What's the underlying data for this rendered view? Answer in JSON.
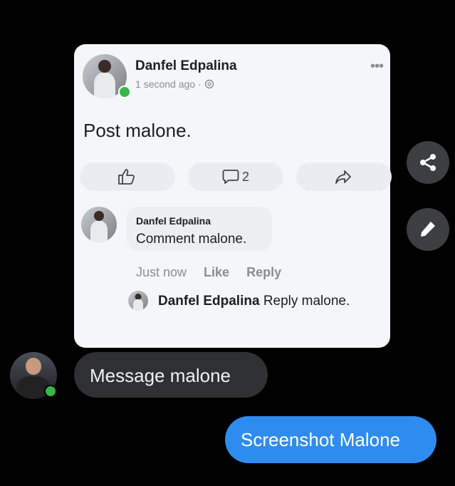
{
  "post": {
    "author": "Danfel Edpalina",
    "time": "1 second ago",
    "separator": "·",
    "more": "•••",
    "text": "Post malone.",
    "comment_count": "2"
  },
  "comment": {
    "author": "Danfel Edpalina",
    "text": "Comment malone.",
    "time": "Just now",
    "like": "Like",
    "reply": "Reply"
  },
  "reply": {
    "author": "Danfel Edpalina",
    "text": "Reply malone."
  },
  "messages": {
    "received": "Message malone",
    "sent": "Screenshot Malone"
  },
  "colors": {
    "background": "#000000",
    "card": "#f5f6f8",
    "sent_bubble": "#2e8cf0",
    "received_bubble": "#2f3032",
    "online": "#3ab54a"
  }
}
